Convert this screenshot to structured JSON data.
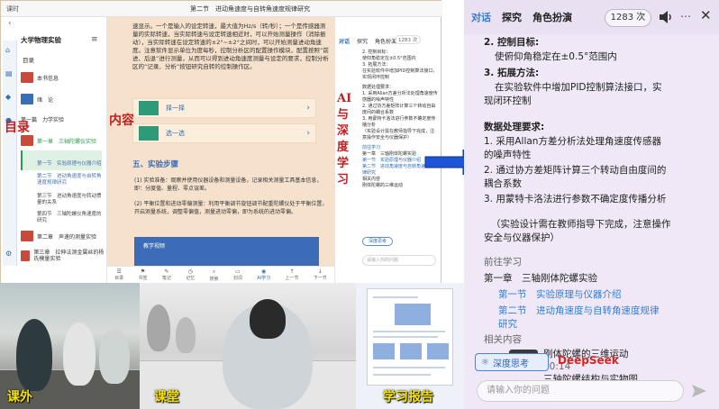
{
  "left": {
    "app_name": "课时",
    "chapter_title": "第二节　进动角速度与自转角速度规律研究",
    "course_title": "大学物理实验",
    "toc_label": "目录",
    "sidebar_items": [
      {
        "label": "本书信息"
      },
      {
        "label": "绪　论"
      },
      {
        "label": "第一篇　力学实验"
      },
      {
        "label": "第一章　三轴陀螺仪实验"
      },
      {
        "label": "第二章　声速的测量实验"
      },
      {
        "label": "第三章　拉伸法测金属丝的杨氏模量实验"
      }
    ],
    "sidebar_subitems": [
      "第一节　实验原理与仪器介绍",
      "第二节　进动角速度与自转角速度规律研究",
      "第三节　进动角速度与转动惯量的关系",
      "第四节　三轴陀螺仪角速度的研究"
    ],
    "overlay_labels": {
      "toc": "目录",
      "content": "内容",
      "ai": "AI与深度学习"
    },
    "content_para": "速显示。一个是输入的设定转速，最大值为Hz/s（转/秒）；一个是传感器测量的实际转速，当实际转速与设定转速相近时，可以开始测量操作（消除振动），当实际转速在设定转速的±2°~±2°之间时，可以开始测量进动角速度。注意软件显示单位为度每秒，控制分析区的配置操作模块，配置按照“前进、后退”进行测量，从而可以得到进动角速度测量与设定的要求，控制分析区的“记录、分析”按钮研究自转的控制操作区。",
    "cards": [
      "择一择",
      "选一选"
    ],
    "section_heading": "五、实验步骤",
    "steps": [
      "(1) 实验准备：观察并使用仪器设备和测量设备，记录相关测量工具基本信息，即：分度值、量程、零点误差。",
      "(2) 平衡位置和进动零偏测量：利用平衡调节旋钮调节配重陀螺仪处于平衡位置，开启测量系统，调整零偏值，测量进动零偏，即为系统的进动零偏。"
    ],
    "video_caption": "教学视频",
    "bottom_tabs": [
      "目录",
      "书签",
      "笔记",
      "记忆",
      "搜索",
      "划词",
      "AI学习",
      "上一节",
      "下一节"
    ],
    "ai_panel": {
      "tabs": [
        "对话",
        "探究",
        "角色扮演"
      ],
      "count": "1283 次",
      "lines": [
        "2. 控制目标：",
        "使仰角稳定在±0.5°范围内",
        "3. 拓展方法：",
        "在实验软件中增加PID控制算法接口，实现闭环控制",
        "数据处理要求：",
        "1. 采用Allan方差分析法处理角速度传感器的噪声特性",
        "2. 通过协方差矩阵计算三个转动自由度间的耦合系数",
        "3. 用蒙特卡洛法进行参数不确定度传播分析",
        "（实验设计需在教师指导下完成，注意操作安全与仪器保护）",
        "前往学习",
        "第一章　三轴刚体陀螺实验",
        "第一节　实验原理与仪器介绍",
        "第二节　进动角速度与自转角速度规律研究",
        "相关内容",
        "刚体陀螺的三维运动"
      ],
      "deep_button": "深度思考",
      "input_placeholder": "请输入你的问题"
    }
  },
  "photos": {
    "p1_caption": "课外",
    "p2_caption": "课堂",
    "p3_caption": "学习报告"
  },
  "right": {
    "tabs": [
      "对话",
      "探究",
      "角色扮演"
    ],
    "count": "1283 次",
    "lines": {
      "l1": "2. 控制目标:",
      "l2": "使俯仰角稳定在±0.5°范围内",
      "l3": "3. 拓展方法:",
      "l4": "在实验软件中增加PID控制算法接口，实",
      "l5": "现闭环控制",
      "l6": "数据处理要求:",
      "l7": "1. 采用Allan方差分析法处理角速度传感器",
      "l8": "的噪声特性",
      "l9": "2. 通过协方差矩阵计算三个转动自由度间的",
      "l10": "耦合系数",
      "l11": "3. 用蒙特卡洛法进行参数不确定度传播分析",
      "l12": "（实验设计需在教师指导下完成，注意操作",
      "l13": "安全与仪器保护）",
      "l14": "前往学习",
      "l15": "第一章　三轴刚体陀螺实验",
      "l16": "第一节　实验原理与仪器介绍",
      "l17": "第二节　进动角速度与自转角速度规律",
      "l18": "研究",
      "l19": "相关内容",
      "l20": "刚体陀螺的三维运动",
      "l21": "00:14",
      "l22": "三轴陀螺结构与实物图"
    },
    "deep_button": "深度思考",
    "deepseek_tag": "DeepSeek",
    "input_placeholder": "请输入你的问题"
  },
  "colors": {
    "accent_blue": "#2f7fd8",
    "label_red": "#c01f1f",
    "label_green": "#1aa64a",
    "arrow_blue": "#1e55d8",
    "caption_yellow": "#f7e400"
  }
}
